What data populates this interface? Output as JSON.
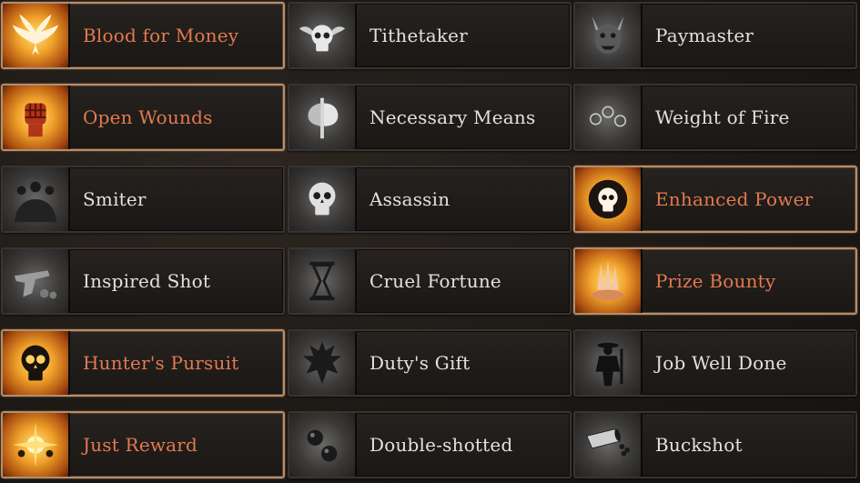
{
  "colors": {
    "active_text": "#e27a4e",
    "inactive_text": "#e4e0dc",
    "active_border": "#b58e6a",
    "inactive_border": "#3a3431"
  },
  "perks": [
    {
      "label": "Blood for Money",
      "icon": "dove-icon",
      "active": true
    },
    {
      "label": "Tithetaker",
      "icon": "winged-skull-icon",
      "active": false
    },
    {
      "label": "Paymaster",
      "icon": "horned-demon-icon",
      "active": false
    },
    {
      "label": "Open Wounds",
      "icon": "raised-fist-icon",
      "active": true
    },
    {
      "label": "Necessary Means",
      "icon": "axe-icon",
      "active": false
    },
    {
      "label": "Weight of Fire",
      "icon": "orbs-icon",
      "active": false
    },
    {
      "label": "Smiter",
      "icon": "shadow-figures-icon",
      "active": false
    },
    {
      "label": "Assassin",
      "icon": "skull-icon",
      "active": false
    },
    {
      "label": "Enhanced Power",
      "icon": "glowing-skull-icon",
      "active": true
    },
    {
      "label": "Inspired Shot",
      "icon": "flintlock-pistol-icon",
      "active": false
    },
    {
      "label": "Cruel Fortune",
      "icon": "hourglass-icon",
      "active": false
    },
    {
      "label": "Prize Bounty",
      "icon": "treasure-pile-icon",
      "active": true
    },
    {
      "label": "Hunter's Pursuit",
      "icon": "flaming-skull-icon",
      "active": true
    },
    {
      "label": "Duty's Gift",
      "icon": "spiked-figure-icon",
      "active": false
    },
    {
      "label": "Job Well Done",
      "icon": "hunter-silhouette-icon",
      "active": false
    },
    {
      "label": "Just Reward",
      "icon": "golden-burst-icon",
      "active": true
    },
    {
      "label": "Double-shotted",
      "icon": "cannonballs-icon",
      "active": false
    },
    {
      "label": "Buckshot",
      "icon": "shot-canister-icon",
      "active": false
    }
  ]
}
